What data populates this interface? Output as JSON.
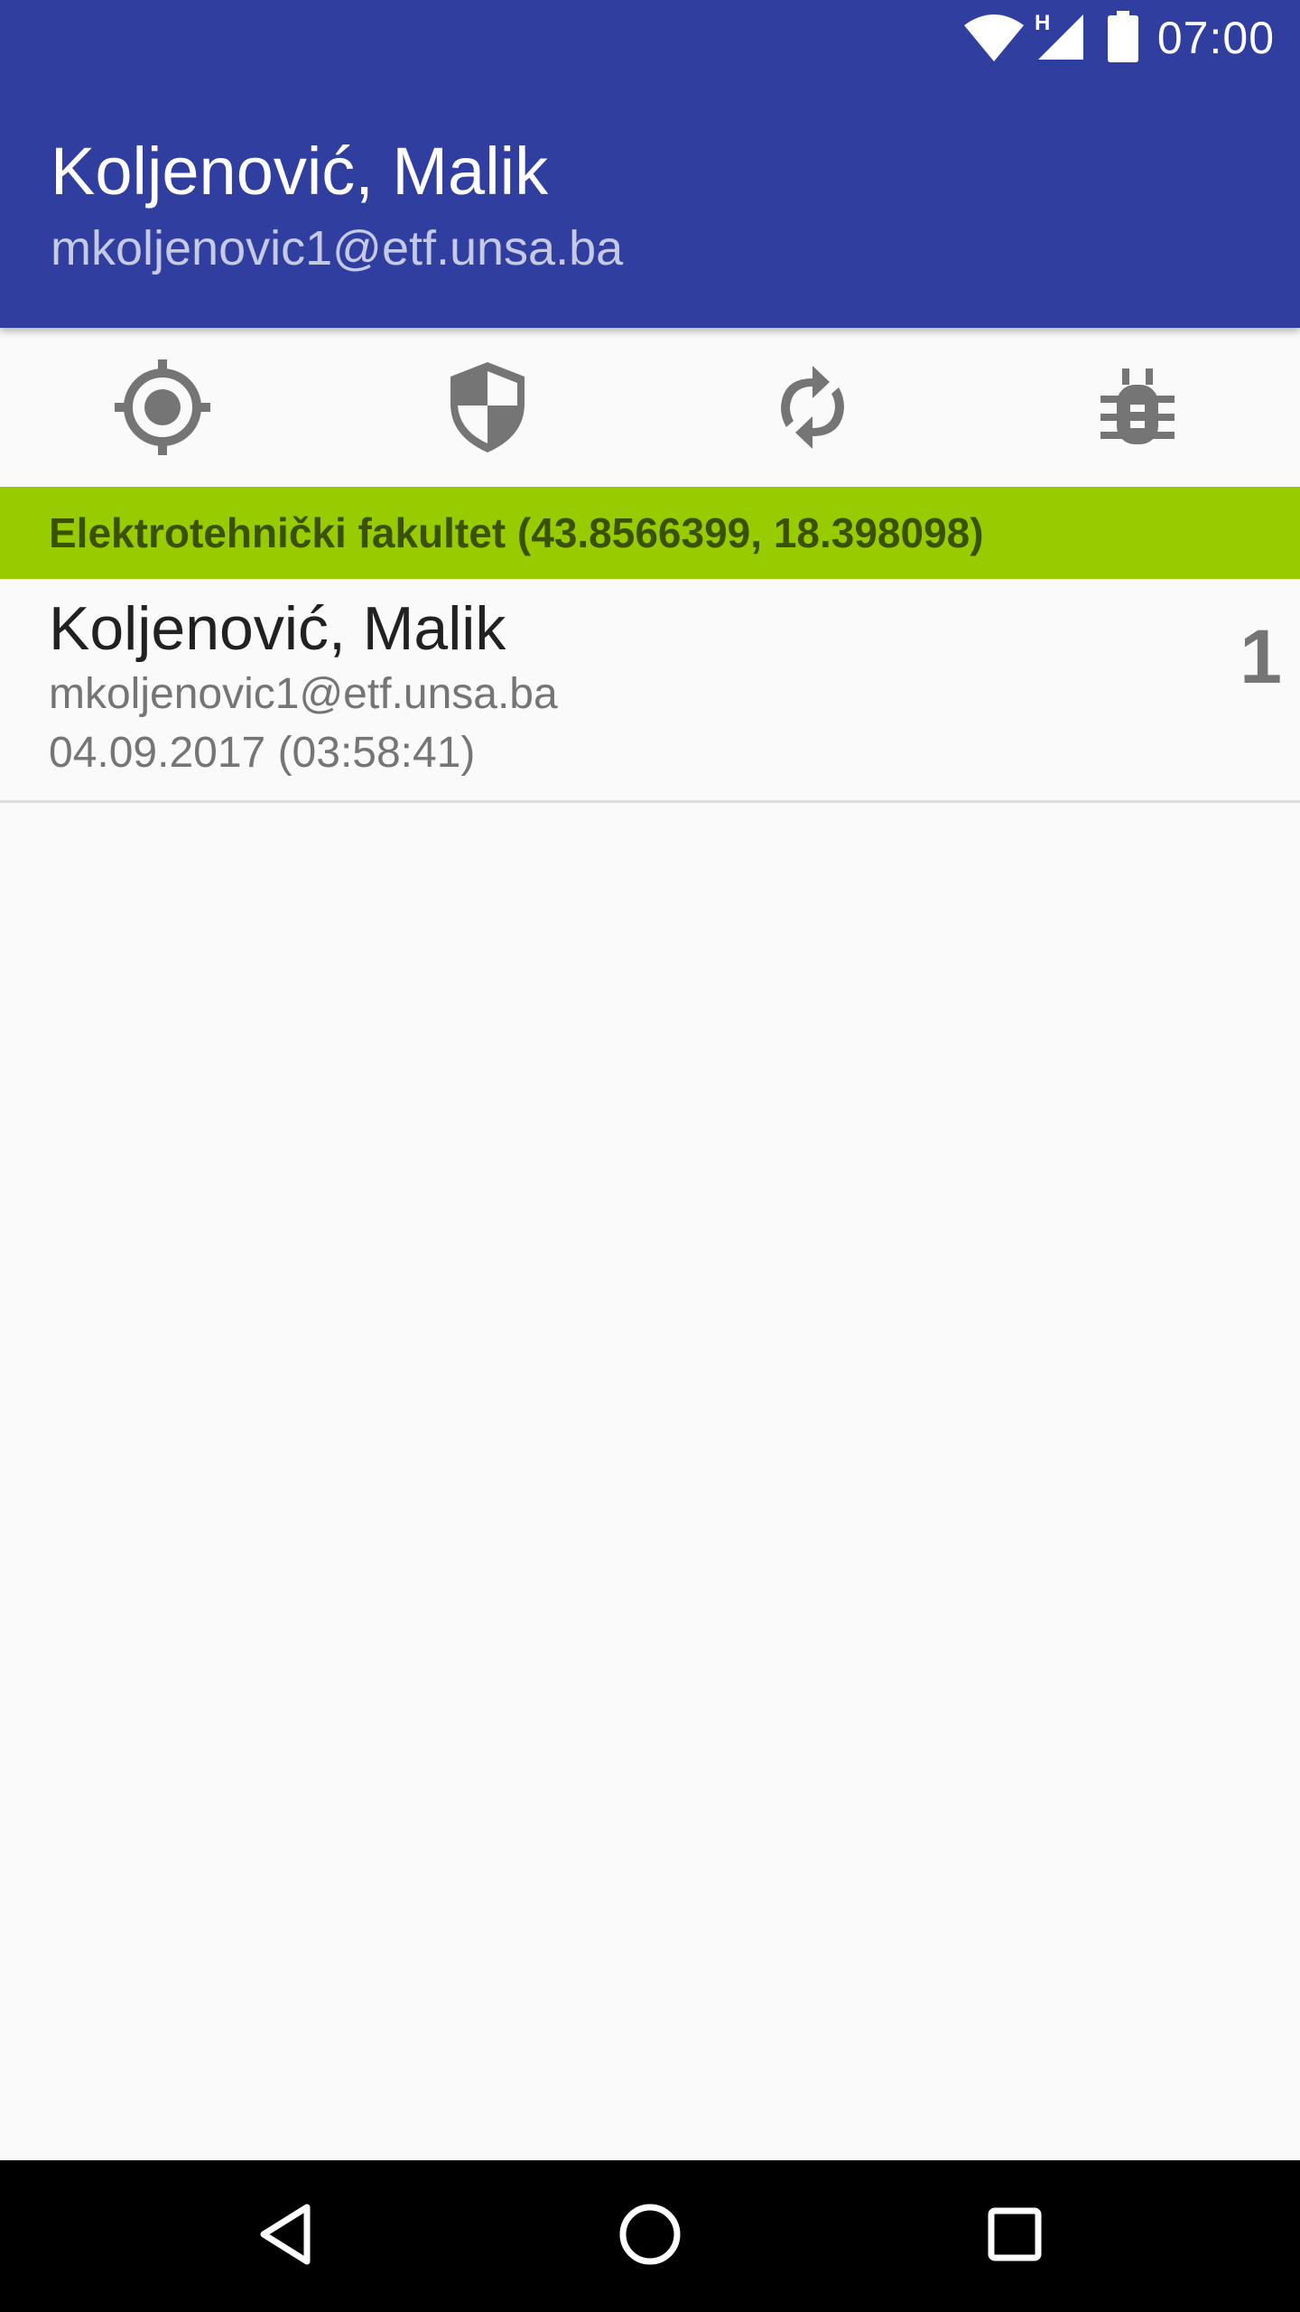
{
  "status_bar": {
    "time": "07:00",
    "network_label": "H",
    "icons": [
      "wifi-icon",
      "cell-signal-icon",
      "battery-icon"
    ]
  },
  "header": {
    "name": "Koljenović, Malik",
    "email": "mkoljenovic1@etf.unsa.ba",
    "color": "#303f9f"
  },
  "toolbar": {
    "buttons": [
      {
        "icon": "gps-location-icon"
      },
      {
        "icon": "security-shield-icon"
      },
      {
        "icon": "sync-icon"
      },
      {
        "icon": "bug-icon"
      }
    ],
    "icon_color": "#757575"
  },
  "location": {
    "label": "Elektrotehnički fakultet (43.8566399, 18.398098)",
    "color": "#99cc00"
  },
  "list": {
    "items": [
      {
        "name": "Koljenović, Malik",
        "email": "mkoljenovic1@etf.unsa.ba",
        "date": "04.09.2017 (03:58:41)",
        "count": "1"
      }
    ]
  },
  "nav_bar": {
    "buttons": [
      "back-icon",
      "home-icon",
      "recents-icon"
    ]
  }
}
